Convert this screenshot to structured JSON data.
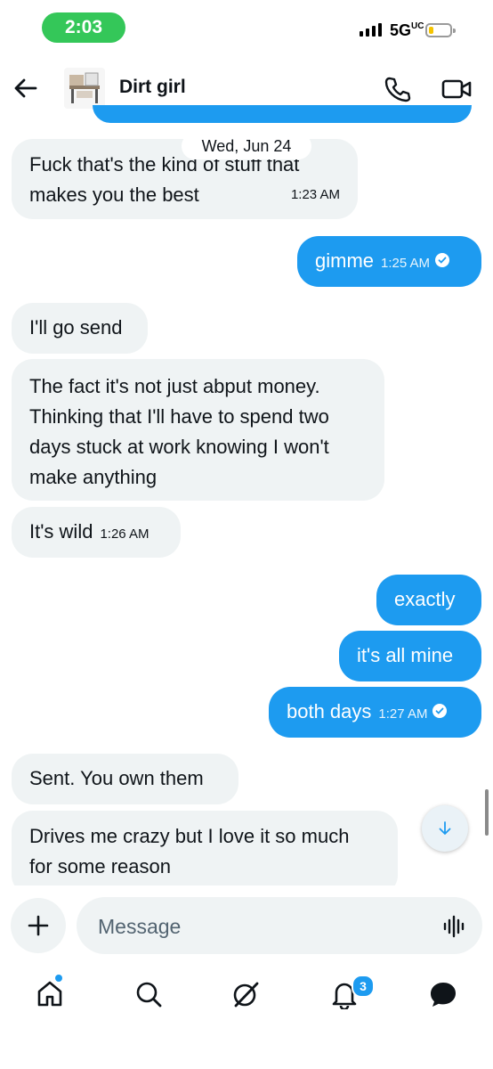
{
  "status_bar": {
    "time": "2:03",
    "network": "5G",
    "battery_level": "low"
  },
  "header": {
    "contact_name": "Dirt girl",
    "back_icon": "arrow-left-icon",
    "call_icon": "phone-icon",
    "video_icon": "video-camera-icon"
  },
  "date_separator": "Wed, Jun 24",
  "messages": [
    {
      "side": "in",
      "text_line1": "Fuck that's the kind of stuff that",
      "text_line2": "makes you the best",
      "time": "1:23 AM"
    },
    {
      "side": "out",
      "text": "gimme",
      "time": "1:25 AM",
      "status": "read"
    },
    {
      "side": "in",
      "text": "I'll go send"
    },
    {
      "side": "in",
      "text_line1": "The fact it's not just abput money.",
      "text_line2": "Thinking that I'll have to spend two",
      "text_line3": "days stuck at work knowing I won't",
      "text_line4": "make anything"
    },
    {
      "side": "in",
      "text": "It's wild",
      "time": "1:26 AM"
    },
    {
      "side": "out",
      "text": "exactly"
    },
    {
      "side": "out",
      "text": "it's all mine"
    },
    {
      "side": "out",
      "text": "both days",
      "time": "1:27 AM",
      "status": "read"
    },
    {
      "side": "in",
      "text": "Sent. You own them"
    },
    {
      "side": "in",
      "text_line1": "Drives me crazy but I love it so much",
      "text_line2": "for some reason"
    }
  ],
  "composer": {
    "placeholder": "Message"
  },
  "tabbar": {
    "items": [
      "home-icon",
      "search-icon",
      "grok-icon",
      "notifications-icon",
      "messages-icon"
    ],
    "notifications_badge": "3"
  },
  "colors": {
    "accent": "#1d9bf0",
    "incoming_bubble": "#eff3f4",
    "time_pill": "#34c759"
  }
}
